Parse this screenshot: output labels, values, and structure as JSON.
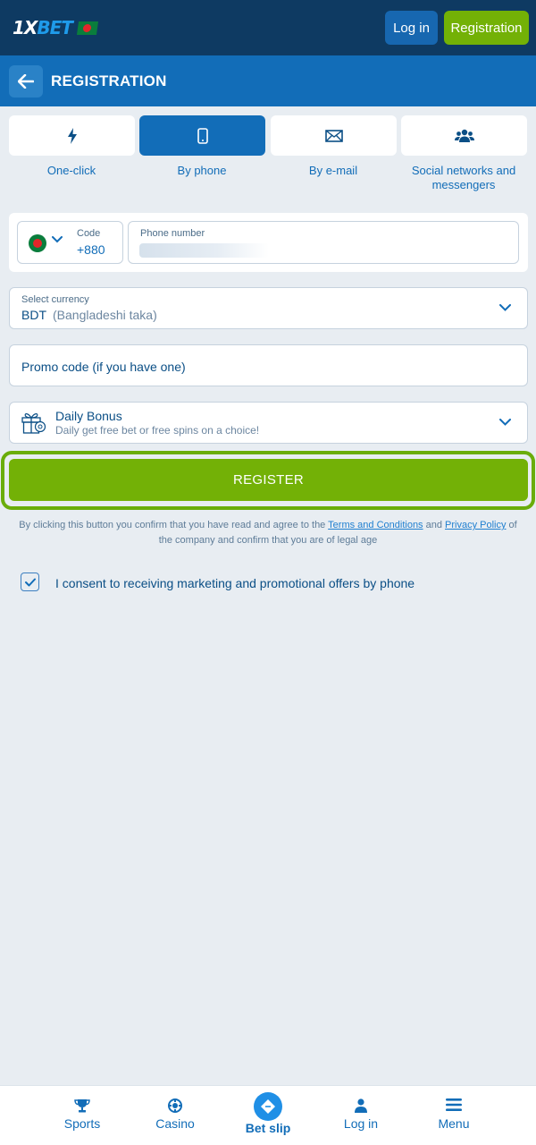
{
  "header": {
    "logo_main": "1X",
    "logo_accent": "BET",
    "login_label": "Log in",
    "registration_label": "Registration"
  },
  "title_bar": {
    "title": "REGISTRATION"
  },
  "tabs": [
    {
      "label": "One-click",
      "icon": "lightning-icon",
      "active": false
    },
    {
      "label": "By phone",
      "icon": "phone-icon",
      "active": true
    },
    {
      "label": "By e-mail",
      "icon": "mail-icon",
      "active": false
    },
    {
      "label": "Social networks and messengers",
      "icon": "users-icon",
      "active": false
    }
  ],
  "phone": {
    "code_label": "Code",
    "code_value": "+880",
    "number_label": "Phone number"
  },
  "currency": {
    "label": "Select currency",
    "value": "BDT",
    "sub": "(Bangladeshi taka)"
  },
  "promo": {
    "placeholder": "Promo code (if you have one)"
  },
  "bonus": {
    "title": "Daily Bonus",
    "subtitle": "Daily get free bet or free spins on a choice!"
  },
  "register": {
    "label": "REGISTER"
  },
  "legal": {
    "text_before": "By clicking this button you confirm that you have read and agree to the ",
    "terms_link": "Terms and Conditions",
    "and": " and ",
    "privacy_link": "Privacy Policy",
    "text_after": " of the company and confirm that you are of legal age"
  },
  "consent": {
    "checked": true,
    "label": "I consent to receiving marketing and promotional offers by phone"
  },
  "bottom_nav": [
    {
      "label": "Sports",
      "icon": "trophy-icon"
    },
    {
      "label": "Casino",
      "icon": "chip-icon"
    },
    {
      "label": "Bet slip",
      "icon": "ticket-icon"
    },
    {
      "label": "Log in",
      "icon": "user-icon"
    },
    {
      "label": "Menu",
      "icon": "menu-icon"
    }
  ],
  "colors": {
    "header_bg": "#0e3a62",
    "title_bg": "#126db8",
    "accent_green": "#73b106",
    "page_bg": "#e8edf2"
  }
}
